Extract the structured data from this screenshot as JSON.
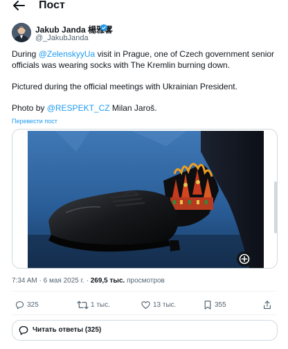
{
  "header": {
    "title": "Пост",
    "back_icon": "arrow-left-icon"
  },
  "author": {
    "name": "Jakub Janda 楊雅畧",
    "handle": "@_JakubJanda",
    "verified_icon": "verified-badge-icon",
    "verified_color": "#1d9bf0"
  },
  "tweet": {
    "p1_before": "During ",
    "p1_mention": "@ZelenskyyUa",
    "p1_after": " visit in Prague, one of Czech government senior officials was wearing socks with The Kremlin burning down.",
    "p2": "Pictured during the official meetings with Ukrainian President.",
    "p3_before": "Photo by ",
    "p3_mention": "@RESPEKT_CZ",
    "p3_after": " Milan Jaroš.",
    "translate_label": "Перевести пост"
  },
  "meta": {
    "time": "7:34 AM",
    "separator": "·",
    "date": "6 мая 2025 г.",
    "views_count": "269,5 тыс.",
    "views_label": "просмотров"
  },
  "actions": {
    "replies": "325",
    "reposts": "1 тыс.",
    "likes": "13 тыс.",
    "bookmarks": "355"
  },
  "read_replies_label": "Читать ответы (325)",
  "colors": {
    "accent": "#1d9bf0",
    "text": "#0f1419",
    "secondary": "#536471",
    "border": "#cfd9de"
  }
}
